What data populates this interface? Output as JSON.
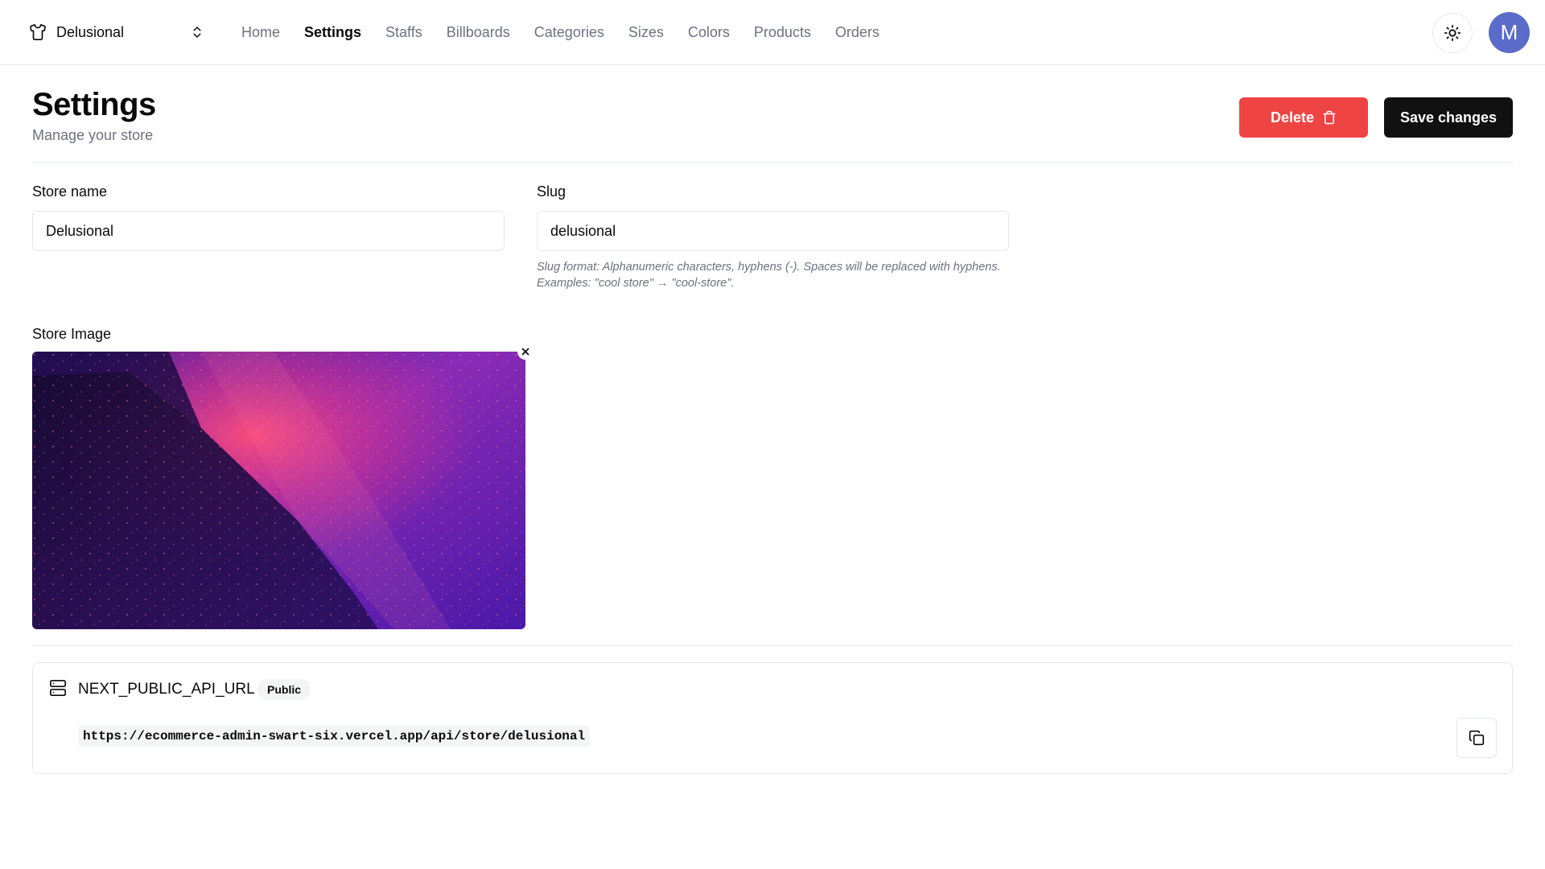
{
  "store_switcher": {
    "name": "Delusional",
    "icon": "shirt-icon",
    "chevron_icon": "chevrons-up-down-icon"
  },
  "nav": {
    "links": [
      {
        "label": "Home",
        "active": false
      },
      {
        "label": "Settings",
        "active": true
      },
      {
        "label": "Staffs",
        "active": false
      },
      {
        "label": "Billboards",
        "active": false
      },
      {
        "label": "Categories",
        "active": false
      },
      {
        "label": "Sizes",
        "active": false
      },
      {
        "label": "Colors",
        "active": false
      },
      {
        "label": "Products",
        "active": false
      },
      {
        "label": "Orders",
        "active": false
      }
    ],
    "theme_icon": "sun-icon",
    "avatar_initial": "M",
    "avatar_color": "#5b6bc9"
  },
  "header": {
    "title": "Settings",
    "subtitle": "Manage your store",
    "delete_label": "Delete",
    "delete_icon": "trash-icon",
    "save_label": "Save changes",
    "delete_color": "#ef4444",
    "save_color": "#111111"
  },
  "form": {
    "store_name_label": "Store name",
    "store_name_value": "Delusional",
    "slug_label": "Slug",
    "slug_value": "delusional",
    "slug_hint": "Slug format: Alphanumeric characters, hyphens (-). Spaces will be replaced with hyphens. Examples: \"cool store\" → \"cool-store\".",
    "store_image_label": "Store Image",
    "remove_image_icon": "close-icon"
  },
  "api": {
    "icon": "server-icon",
    "name": "NEXT_PUBLIC_API_URL",
    "badge": "Public",
    "url": "https://ecommerce-admin-swart-six.vercel.app/api/store/delusional",
    "copy_icon": "copy-icon"
  }
}
